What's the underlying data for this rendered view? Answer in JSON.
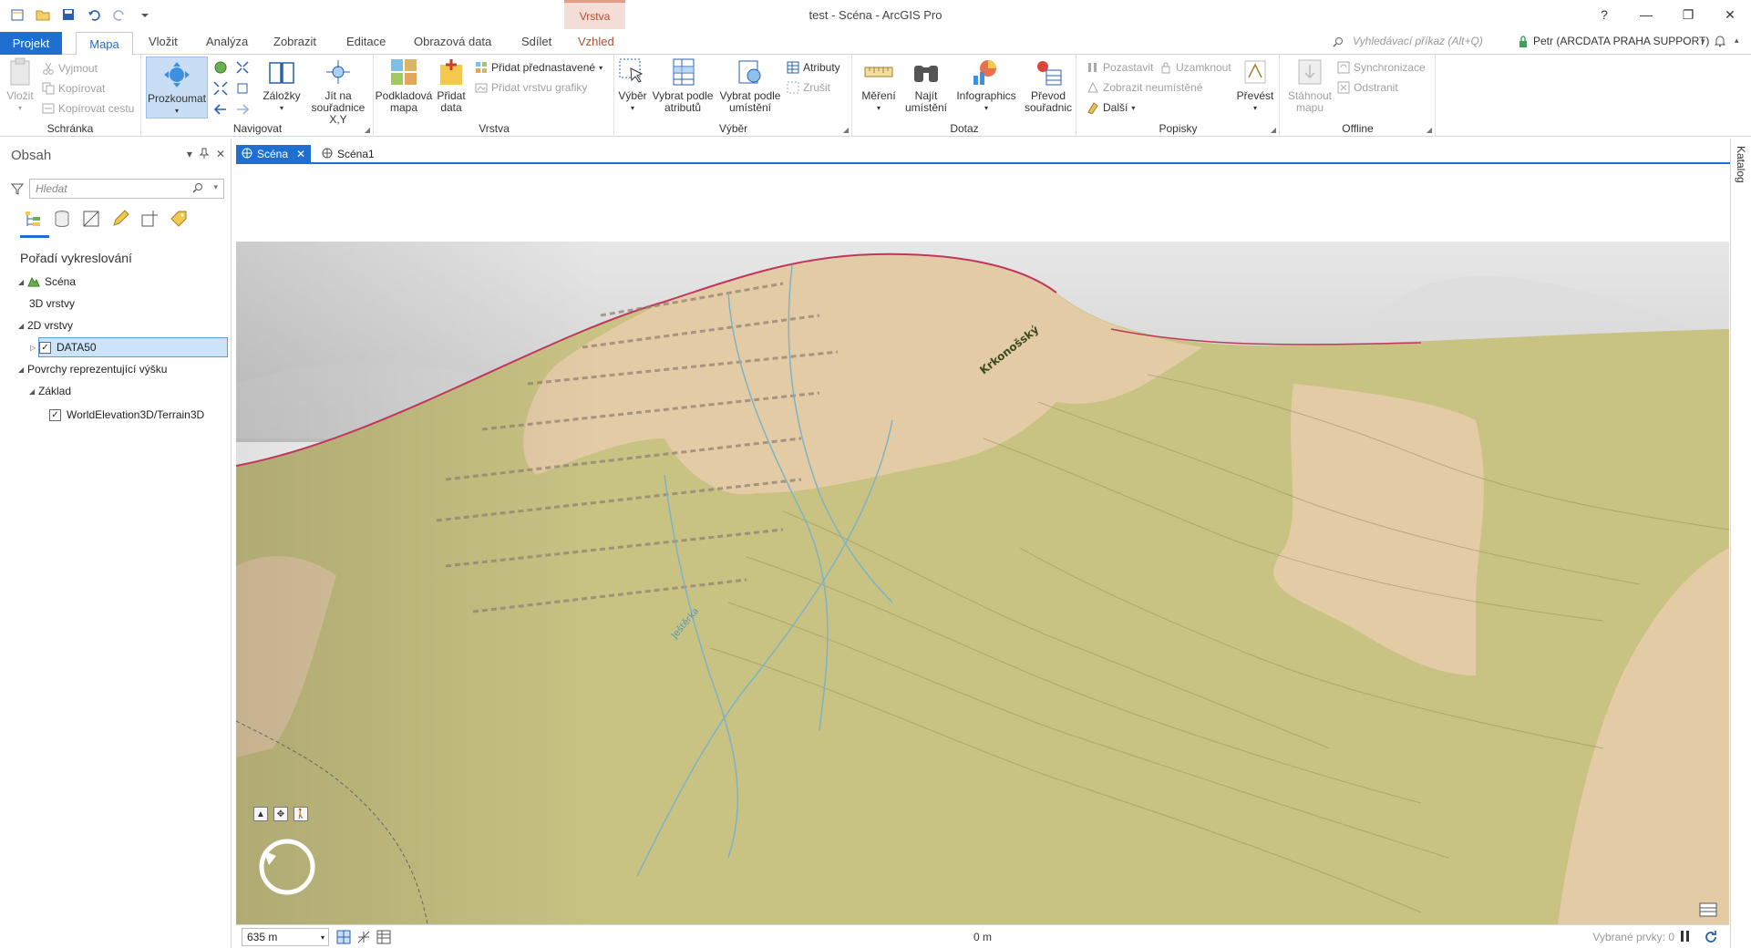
{
  "titlebar": {
    "title": "test - Scéna - ArcGIS Pro",
    "context_group": "Vrstva",
    "help": "?",
    "minimize": "—",
    "restore": "❐",
    "close": "✕"
  },
  "tabs": {
    "project": "Projekt",
    "map": "Mapa",
    "insert": "Vložit",
    "analysis": "Analýza",
    "view": "Zobrazit",
    "edit": "Editace",
    "imagery": "Obrazová data",
    "share": "Sdílet",
    "appearance": "Vzhled"
  },
  "command_search": {
    "placeholder": "Vyhledávací příkaz (Alt+Q)"
  },
  "user": {
    "name": "Petr (ARCDATA PRAHA SUPPORT)"
  },
  "ribbon": {
    "clipboard": {
      "label": "Schránka",
      "paste": "Vložit",
      "cut": "Vyjmout",
      "copy": "Kopírovat",
      "copy_path": "Kopírovat cestu"
    },
    "navigate": {
      "label": "Navigovat",
      "explore": "Prozkoumat",
      "bookmarks": "Záložky",
      "goto_line1": "Jít na",
      "goto_line2": "souřadnice X,Y"
    },
    "layer": {
      "label": "Vrstva",
      "basemap_line1": "Podkladová",
      "basemap_line2": "mapa",
      "add_data_line1": "Přidat",
      "add_data_line2": "data",
      "add_preset": "Přidat přednastavené",
      "add_graphics": "Přidat vrstvu grafiky"
    },
    "selection": {
      "label": "Výběr",
      "select": "Výběr",
      "by_attr_line1": "Vybrat podle",
      "by_attr_line2": "atributů",
      "by_loc_line1": "Vybrat podle",
      "by_loc_line2": "umístění",
      "attributes": "Atributy",
      "clear": "Zrušit"
    },
    "inquiry": {
      "label": "Dotaz",
      "measure": "Měření",
      "locate_line1": "Najít",
      "locate_line2": "umístění",
      "infographics": "Infographics",
      "convert_line1": "Převod",
      "convert_line2": "souřadnic"
    },
    "labeling": {
      "label": "Popisky",
      "pause": "Pozastavit",
      "lock": "Uzamknout",
      "show_unplaced": "Zobrazit neumístěné",
      "more": "Další",
      "convert": "Převést"
    },
    "offline": {
      "label": "Offline",
      "download_line1": "Stáhnout",
      "download_line2": "mapu",
      "sync": "Synchronizace",
      "remove": "Odstranit"
    }
  },
  "contents": {
    "title": "Obsah",
    "search_placeholder": "Hledat",
    "drawing_order": "Pořadí vykreslování",
    "scene": "Scéna",
    "layers_3d": "3D vrstvy",
    "layers_2d": "2D vrstvy",
    "data50": "DATA50",
    "elevation_surfaces": "Povrchy reprezentující výšku",
    "ground": "Základ",
    "terrain": "WorldElevation3D/Terrain3D"
  },
  "view_tabs": {
    "active": "Scéna",
    "inactive": "Scéna1"
  },
  "right_strip": {
    "catalog": "Katalog"
  },
  "map_labels": {
    "ridge": "Krkonošský",
    "stream": "Ještěrka"
  },
  "status": {
    "scale": "635 m",
    "coordinate": "0 m",
    "selected": "Vybrané prvky: 0"
  },
  "colors": {
    "accent": "#1f6fd1",
    "context": "#b24d34",
    "terrain_green": "#c8c283",
    "terrain_tan": "#e3cba6",
    "stream": "#7fb3c4"
  }
}
